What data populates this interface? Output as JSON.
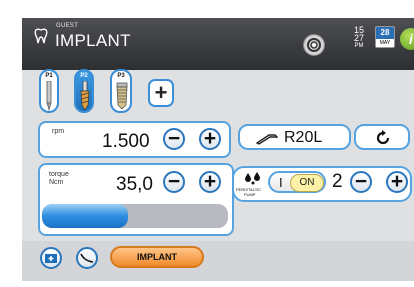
{
  "header": {
    "user": "GUEST",
    "title": "IMPLANT",
    "time_hour": "15",
    "time_minute": "27",
    "time_ampm": "PM",
    "date_day": "28",
    "date_month": "MAY",
    "info_label": "i"
  },
  "tools": [
    {
      "label": "P1",
      "selected": false
    },
    {
      "label": "P2",
      "selected": true
    },
    {
      "label": "P3",
      "selected": false
    }
  ],
  "add_tool_label": "+",
  "speed": {
    "label": "rpm",
    "value": "1.500",
    "minus": "−",
    "plus": "+"
  },
  "contra_angle": {
    "label": "R20L"
  },
  "torque": {
    "label_line1": "torque",
    "label_line2": "Ncm",
    "value": "35,0",
    "minus": "−",
    "plus": "+",
    "level": 0.46
  },
  "pump": {
    "icon_label_1": "PERISTALTIC",
    "icon_label_2": "PUMP",
    "toggle_off": "I",
    "toggle_on": "ON",
    "value": "2",
    "minus": "−",
    "plus": "+"
  },
  "bottom": {
    "implant_button": "IMPLANT"
  },
  "colors": {
    "accent": "#2b76bd",
    "orange": "#f08a2a",
    "toggle": "#fdf1a8"
  }
}
